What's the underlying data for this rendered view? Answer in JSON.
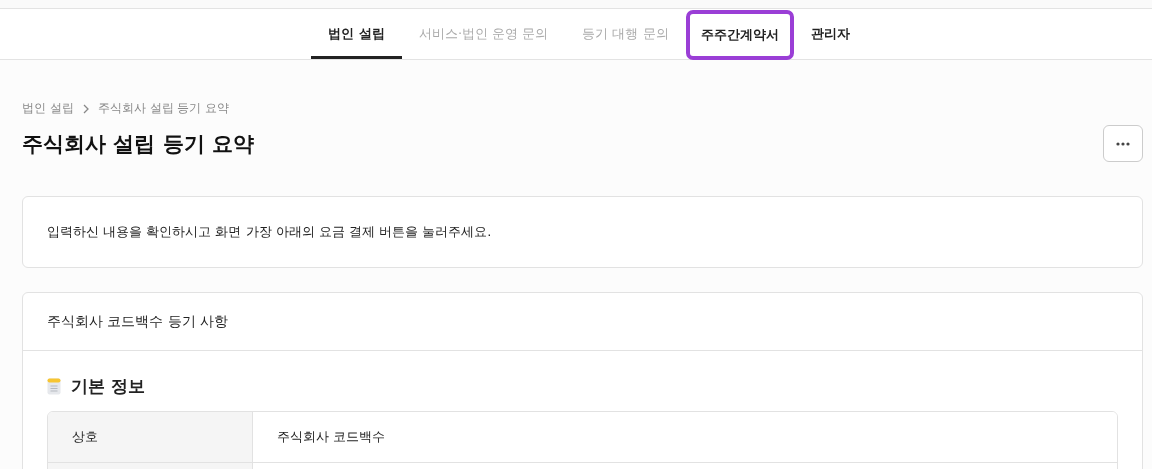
{
  "tabs": [
    {
      "label": "법인 설립",
      "selected": true,
      "disabled": false,
      "highlighted": false
    },
    {
      "label": "서비스·법인 운영 문의",
      "selected": false,
      "disabled": true,
      "highlighted": false
    },
    {
      "label": "등기 대행 문의",
      "selected": false,
      "disabled": true,
      "highlighted": false
    },
    {
      "label": "주주간계약서",
      "selected": false,
      "disabled": false,
      "highlighted": true
    },
    {
      "label": "관리자",
      "selected": false,
      "disabled": false,
      "highlighted": false
    }
  ],
  "breadcrumb": [
    "법인 설립",
    "주식회사 설립 등기 요약"
  ],
  "title": "주식회사 설립 등기 요약",
  "notice": "입력하신 내용을 확인하시고 화면 가장 아래의 요금 결제 버튼을 눌러주세요.",
  "section": {
    "title": "주식회사 코드백수 등기 사항",
    "subsection": "기본 정보",
    "rows": [
      {
        "label": "상호",
        "value": "주식회사 코드백수"
      }
    ]
  }
}
